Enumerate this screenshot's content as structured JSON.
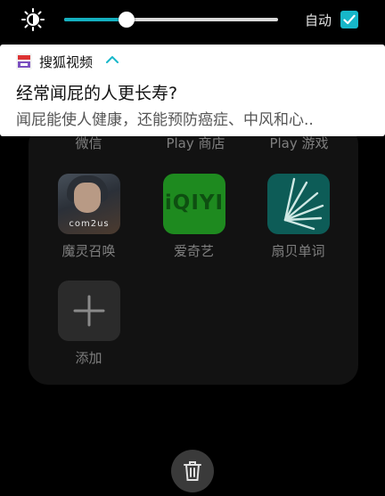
{
  "status_bar": {
    "brightness_icon": "sun-icon",
    "brightness_level": 0.29,
    "auto_label": "自动",
    "auto_checked": true
  },
  "notification": {
    "app_name": "搜狐视频",
    "title": "经常闻屁的人更长寿?",
    "body": "闻屁能使人健康，还能预防癌症、中风和心.."
  },
  "drawer": {
    "row0": [
      "微信",
      "Play 商店",
      "Play 游戏"
    ],
    "apps": [
      {
        "label": "魔灵召唤",
        "icon_text": "com2us"
      },
      {
        "label": "爱奇艺",
        "icon_text": "iQIYI"
      },
      {
        "label": "扇贝单词"
      }
    ],
    "add_label": "添加"
  },
  "colors": {
    "accent": "#17b7c9",
    "iqiyi_green": "#1e8a1f",
    "shanbay_teal": "#0d5c57"
  }
}
